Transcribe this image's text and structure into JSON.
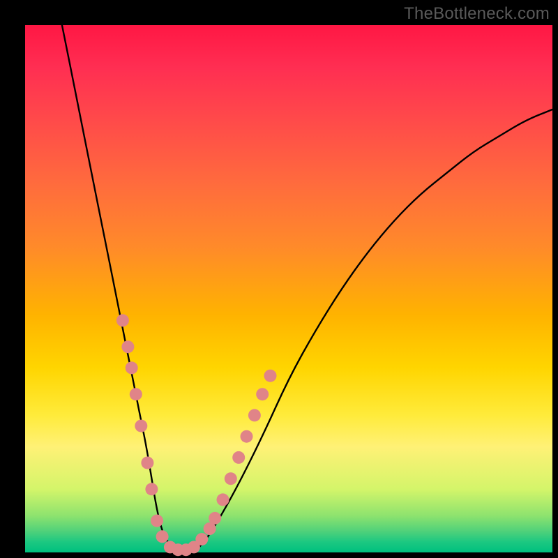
{
  "watermark": "TheBottleneck.com",
  "chart_data": {
    "type": "line",
    "title": "",
    "xlabel": "",
    "ylabel": "",
    "xlim": [
      0,
      100
    ],
    "ylim": [
      0,
      100
    ],
    "grid": false,
    "series": [
      {
        "name": "curve",
        "x": [
          7,
          10,
          13,
          15,
          17,
          19,
          20,
          21,
          22,
          23,
          24,
          25,
          26,
          27,
          28,
          30,
          32,
          34,
          36,
          40,
          45,
          50,
          55,
          60,
          65,
          70,
          75,
          80,
          85,
          90,
          95,
          100
        ],
        "y": [
          100,
          85,
          70,
          60,
          50,
          40,
          35,
          30,
          25,
          20,
          14,
          8,
          4,
          2,
          1,
          0,
          0,
          2,
          5,
          12,
          22,
          33,
          42,
          50,
          57,
          63,
          68,
          72,
          76,
          79,
          82,
          84
        ]
      }
    ],
    "markers": {
      "color": "#e08488",
      "radius_px": 9,
      "points_xy": [
        [
          18.5,
          44
        ],
        [
          19.5,
          39
        ],
        [
          20.2,
          35
        ],
        [
          21,
          30
        ],
        [
          22,
          24
        ],
        [
          23.2,
          17
        ],
        [
          24,
          12
        ],
        [
          25,
          6
        ],
        [
          26,
          3
        ],
        [
          27.5,
          1
        ],
        [
          29,
          0.5
        ],
        [
          30.5,
          0.5
        ],
        [
          32,
          1
        ],
        [
          33.5,
          2.5
        ],
        [
          35,
          4.5
        ],
        [
          36,
          6.5
        ],
        [
          37.5,
          10
        ],
        [
          39,
          14
        ],
        [
          40.5,
          18
        ],
        [
          42,
          22
        ],
        [
          43.5,
          26
        ],
        [
          45,
          30
        ],
        [
          46.5,
          33.5
        ]
      ]
    }
  }
}
